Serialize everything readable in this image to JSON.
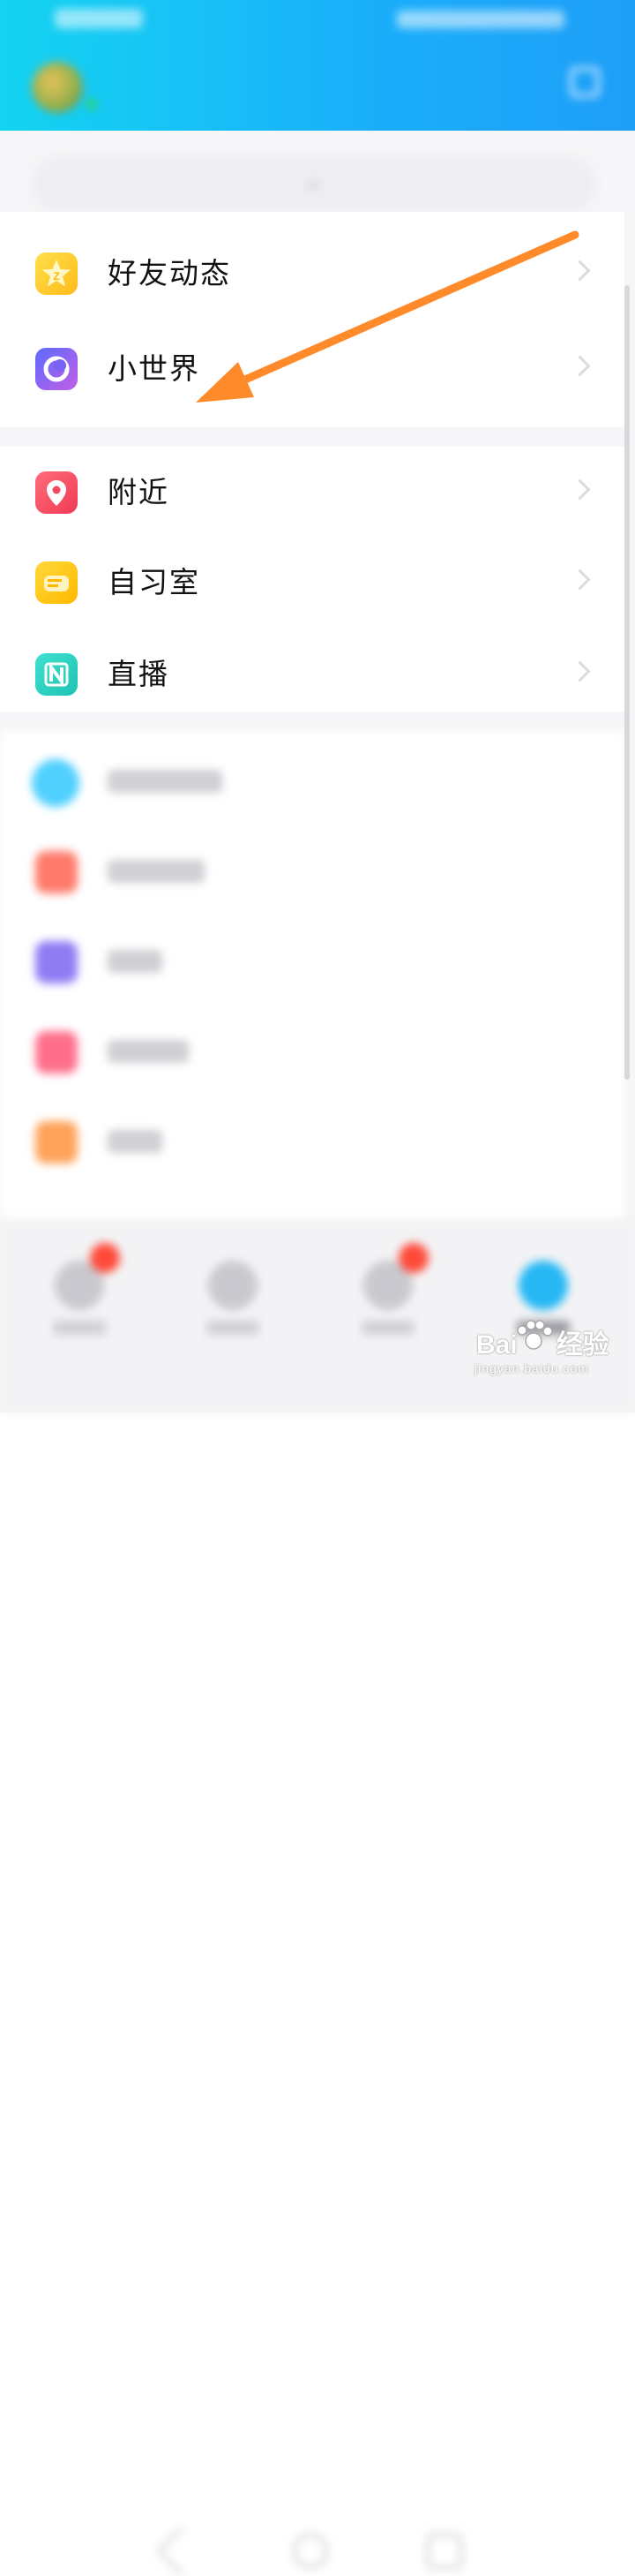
{
  "colors": {
    "header_start": "#14d4f2",
    "header_end": "#1e9ef8",
    "arrow": "#ff8a2a",
    "friends_icon": "#ffcc2e",
    "world_icon": "#7a5cf0",
    "nearby_icon": "#f24a5c",
    "study_icon": "#ffc21a",
    "live_icon": "#2ed3c0",
    "games_icon": "#4fd0ff",
    "vip_icon": "#ff7a6a",
    "mall_icon": "#8f7cf5",
    "game2_icon": "#ff6f8c",
    "music_icon": "#ffa25a"
  },
  "header": {
    "title": "",
    "avatar": "avatar-icon",
    "edit_icon": "edit-icon"
  },
  "search": {
    "placeholder": ""
  },
  "sections": [
    {
      "items": [
        {
          "label": "好友动态",
          "icon": "star-icon"
        },
        {
          "label": "小世界",
          "icon": "planet-icon"
        }
      ]
    },
    {
      "items": [
        {
          "label": "附近",
          "icon": "location-pin-icon"
        },
        {
          "label": "自习室",
          "icon": "cat-icon"
        },
        {
          "label": "直播",
          "icon": "live-n-icon"
        }
      ]
    },
    {
      "items": [
        {
          "label": "",
          "icon": "game-icon"
        },
        {
          "label": "",
          "icon": "vip-icon"
        },
        {
          "label": "",
          "icon": "mall-icon"
        },
        {
          "label": "",
          "icon": "game-center-icon"
        },
        {
          "label": "",
          "icon": "music-icon"
        }
      ]
    }
  ],
  "bottom_nav": {
    "tabs": [
      {
        "icon": "message-icon",
        "badge": true
      },
      {
        "icon": "contacts-icon",
        "badge": false
      },
      {
        "icon": "dynamic-icon",
        "badge": true
      },
      {
        "icon": "explore-icon",
        "badge": false
      }
    ]
  },
  "watermark": {
    "text": "Bai",
    "text2": "经验",
    "sub": "jingyan.baidu.com"
  }
}
